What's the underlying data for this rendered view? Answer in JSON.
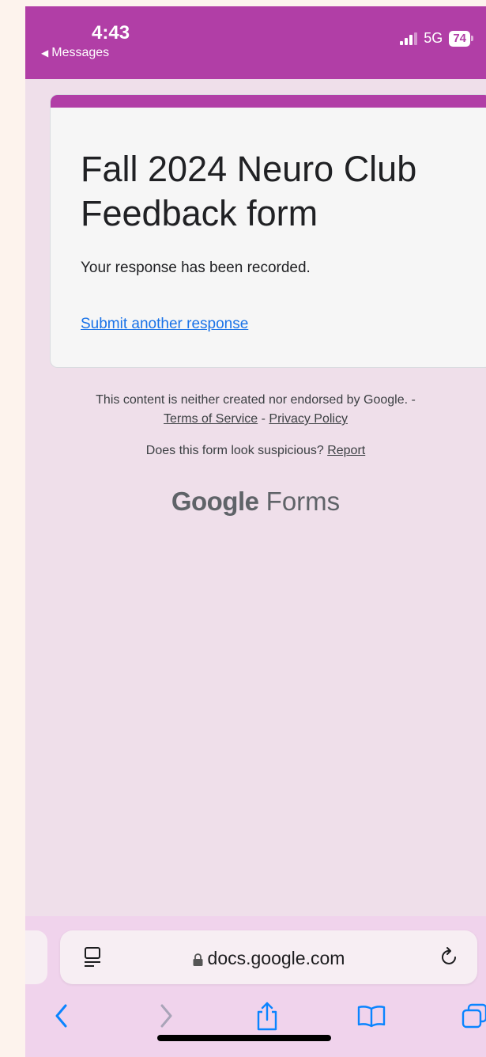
{
  "status_bar": {
    "time": "4:43",
    "back_app": "Messages",
    "network": "5G",
    "battery": "74"
  },
  "form": {
    "title": "Fall 2024 Neuro Club Feedback form",
    "confirmation": "Your response has been recorded.",
    "another_link": "Submit another response"
  },
  "footer": {
    "disclaimer": "This content is neither created nor endorsed by Google. -",
    "terms": "Terms of Service",
    "separator": "-",
    "privacy": "Privacy Policy",
    "suspicious": "Does this form look suspicious?",
    "report": "Report",
    "brand_google": "Google",
    "brand_forms": "Forms"
  },
  "browser": {
    "url": "docs.google.com"
  },
  "icons": {
    "page_menu": "page-menu-icon",
    "lock": "lock-icon",
    "reload": "reload-icon",
    "back": "chevron-left-icon",
    "forward": "chevron-right-icon",
    "share": "share-icon",
    "bookmarks": "book-icon",
    "tabs": "tabs-icon"
  },
  "colors": {
    "accent": "#b13ea6",
    "link": "#1a73e8",
    "toolbar_icon": "#0a84ff"
  }
}
